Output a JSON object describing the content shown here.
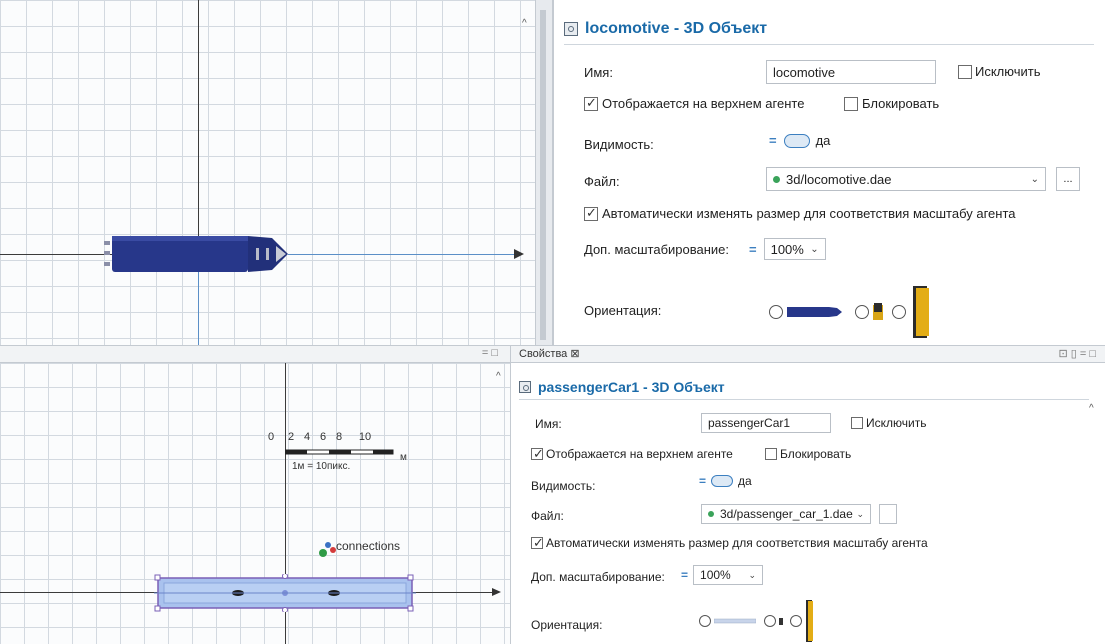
{
  "top": {
    "title": "locomotive - 3D Объект",
    "name_label": "Имя:",
    "name_value": "locomotive",
    "exclude_label": "Исключить",
    "show_top_label": "Отображается на верхнем агенте",
    "lock_label": "Блокировать",
    "visibility_label": "Видимость:",
    "visibility_value": "да",
    "file_label": "Файл:",
    "file_value": "3d/locomotive.dae",
    "browse_label": "...",
    "auto_resize_label": "Автоматически изменять размер для соответствия масштабу агента",
    "scale_label": "Доп. масштабирование:",
    "scale_value": "100%",
    "orientation_label": "Ориентация:"
  },
  "bottom": {
    "view_tab_controls": "= □",
    "props_tab": "Свойства ⊠",
    "props_tab_controls": "⊡ ▯ = □",
    "title": "passengerCar1 - 3D Объект",
    "name_label": "Имя:",
    "name_value": "passengerCar1",
    "exclude_label": "Исключить",
    "show_top_label": "Отображается на верхнем агенте",
    "lock_label": "Блокировать",
    "visibility_label": "Видимость:",
    "visibility_value": "да",
    "file_label": "Файл:",
    "file_value": "3d/passenger_car_1.dae",
    "auto_resize_label": "Автоматически изменять размер для соответствия масштабу агента",
    "scale_label": "Доп. масштабирование:",
    "scale_value": "100%",
    "orientation_label": "Ориентация:"
  },
  "scale_bar": {
    "ticks": [
      "0",
      "2",
      "4",
      "6",
      "8",
      "10"
    ],
    "unit": "м",
    "ratio": "1м = 10пикс."
  },
  "connections_label": "connections",
  "colors": {
    "accent": "#1a6aa8",
    "locomotive": "#27378a",
    "car_fill": "#a9c2ee",
    "car_border": "#7a5fb6"
  }
}
